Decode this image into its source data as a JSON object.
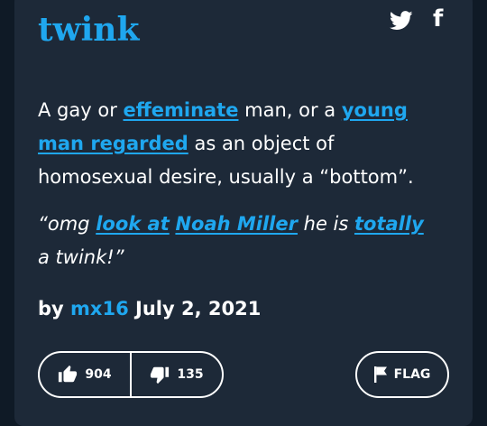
{
  "colors": {
    "background": "#1d2938",
    "accent": "#1fa7ef",
    "text": "#ffffff"
  },
  "definition": {
    "word": "twink",
    "meaning": {
      "t1": "A gay or ",
      "l1": "effeminate",
      "t2": " man, or a ",
      "l2": "young man regarded",
      "t3": " as an object of homosexual desire, usually a “bottom”."
    },
    "example": {
      "t1": "“omg ",
      "l1": "look at",
      "t2": " ",
      "l2": "Noah Miller",
      "t3": " he is ",
      "l3": "totally",
      "t4": " a twink!”"
    },
    "byline": {
      "prefix": "by",
      "author": "mx16",
      "date": "July 2, 2021"
    }
  },
  "share": {
    "twitter_icon": "twitter-bird-icon",
    "facebook_icon": "facebook-f-icon",
    "facebook_glyph": "f"
  },
  "votes": {
    "up_count": "904",
    "down_count": "135",
    "up_icon": "thumbs-up-icon",
    "down_icon": "thumbs-down-icon"
  },
  "flag": {
    "label": "FLAG",
    "icon": "flag-icon"
  }
}
